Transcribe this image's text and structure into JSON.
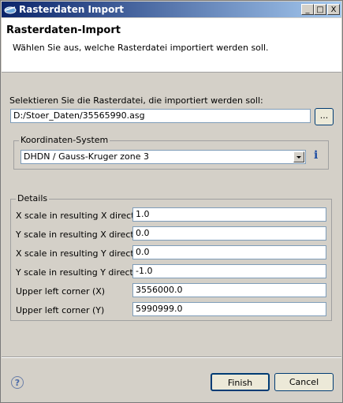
{
  "window": {
    "title": "Rasterdaten Import",
    "minimize_glyph": "_",
    "maximize_glyph": "□",
    "close_glyph": "X"
  },
  "header": {
    "title": "Rasterdaten-Import",
    "description": "Wählen Sie aus, welche Rasterdatei importiert werden soll."
  },
  "file": {
    "label": "Selektieren Sie die Rasterdatei, die importiert werden soll:",
    "value": "D:/Stoer_Daten/35565990.asg",
    "browse_label": "..."
  },
  "crs": {
    "group_title": "Koordinaten-System",
    "selected": "DHDN / Gauss-Kruger zone 3",
    "info_glyph": "i"
  },
  "details": {
    "group_title": "Details",
    "rows": [
      {
        "label": "X scale in resulting X direction",
        "value": "1.0"
      },
      {
        "label": "Y scale in resulting X direction",
        "value": "0.0"
      },
      {
        "label": "X scale in resulting Y direction",
        "value": "0.0"
      },
      {
        "label": "Y scale in resulting Y direction",
        "value": "-1.0"
      },
      {
        "label": "Upper left corner (X)",
        "value": "3556000.0"
      },
      {
        "label": "Upper left corner (Y)",
        "value": "5990999.0"
      }
    ]
  },
  "footer": {
    "help_glyph": "?",
    "finish_label": "Finish",
    "cancel_label": "Cancel"
  }
}
